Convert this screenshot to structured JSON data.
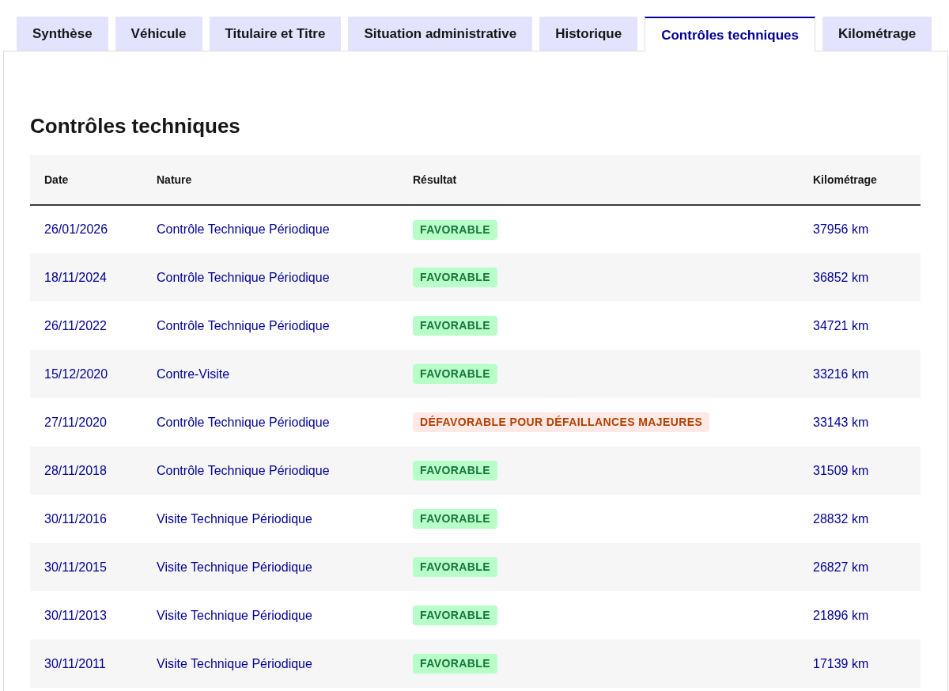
{
  "tabs": [
    {
      "label": "Synthèse",
      "selected": false
    },
    {
      "label": "Véhicule",
      "selected": false
    },
    {
      "label": "Titulaire et Titre",
      "selected": false
    },
    {
      "label": "Situation administrative",
      "selected": false
    },
    {
      "label": "Historique",
      "selected": false
    },
    {
      "label": "Contrôles techniques",
      "selected": true
    },
    {
      "label": "Kilométrage",
      "selected": false
    }
  ],
  "panel": {
    "title": "Contrôles techniques",
    "table": {
      "columns": [
        "Date",
        "Nature",
        "Résultat",
        "Kilométrage"
      ],
      "rows": [
        {
          "date": "26/01/2026",
          "nature": "Contrôle Technique Périodique",
          "result": {
            "label": "FAVORABLE",
            "kind": "success"
          },
          "mileage": "37956 km"
        },
        {
          "date": "18/11/2024",
          "nature": "Contrôle Technique Périodique",
          "result": {
            "label": "FAVORABLE",
            "kind": "success"
          },
          "mileage": "36852 km"
        },
        {
          "date": "26/11/2022",
          "nature": "Contrôle Technique Périodique",
          "result": {
            "label": "FAVORABLE",
            "kind": "success"
          },
          "mileage": "34721 km"
        },
        {
          "date": "15/12/2020",
          "nature": "Contre-Visite",
          "result": {
            "label": "FAVORABLE",
            "kind": "success"
          },
          "mileage": "33216 km"
        },
        {
          "date": "27/11/2020",
          "nature": "Contrôle Technique Périodique",
          "result": {
            "label": "DÉFAVORABLE POUR DÉFAILLANCES MAJEURES",
            "kind": "error"
          },
          "mileage": "33143 km"
        },
        {
          "date": "28/11/2018",
          "nature": "Contrôle Technique Périodique",
          "result": {
            "label": "FAVORABLE",
            "kind": "success"
          },
          "mileage": "31509 km"
        },
        {
          "date": "30/11/2016",
          "nature": "Visite Technique Périodique",
          "result": {
            "label": "FAVORABLE",
            "kind": "success"
          },
          "mileage": "28832 km"
        },
        {
          "date": "30/11/2015",
          "nature": "Visite Technique Périodique",
          "result": {
            "label": "FAVORABLE",
            "kind": "success"
          },
          "mileage": "26827 km"
        },
        {
          "date": "30/11/2013",
          "nature": "Visite Technique Périodique",
          "result": {
            "label": "FAVORABLE",
            "kind": "success"
          },
          "mileage": "21896 km"
        },
        {
          "date": "30/11/2011",
          "nature": "Visite Technique Périodique",
          "result": {
            "label": "FAVORABLE",
            "kind": "success"
          },
          "mileage": "17139 km"
        }
      ]
    }
  }
}
